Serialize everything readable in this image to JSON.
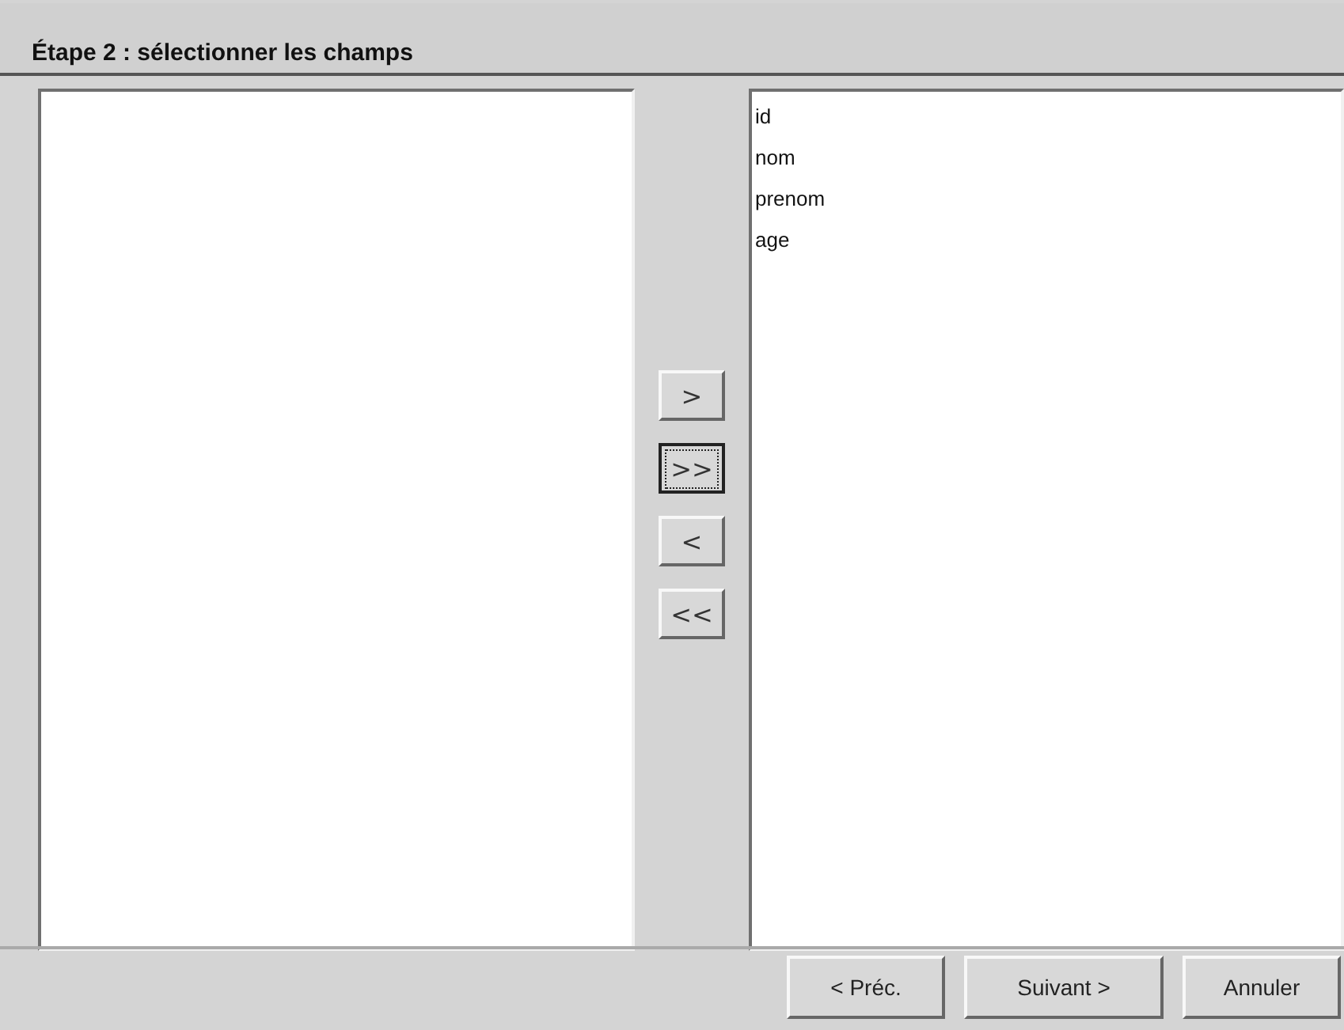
{
  "step_title": "Étape 2 : sélectionner les champs",
  "move_buttons": [
    {
      "label": ">",
      "focused": false
    },
    {
      "label": ">>",
      "focused": true
    },
    {
      "label": "<",
      "focused": false
    },
    {
      "label": "<<",
      "focused": false
    }
  ],
  "selected_fields": [
    {
      "label": "id"
    },
    {
      "label": "nom"
    },
    {
      "label": "prenom"
    },
    {
      "label": "age"
    }
  ],
  "nav_buttons": [
    {
      "label": "< Préc."
    },
    {
      "label": "Suivant >"
    },
    {
      "label": "Annuler"
    }
  ]
}
